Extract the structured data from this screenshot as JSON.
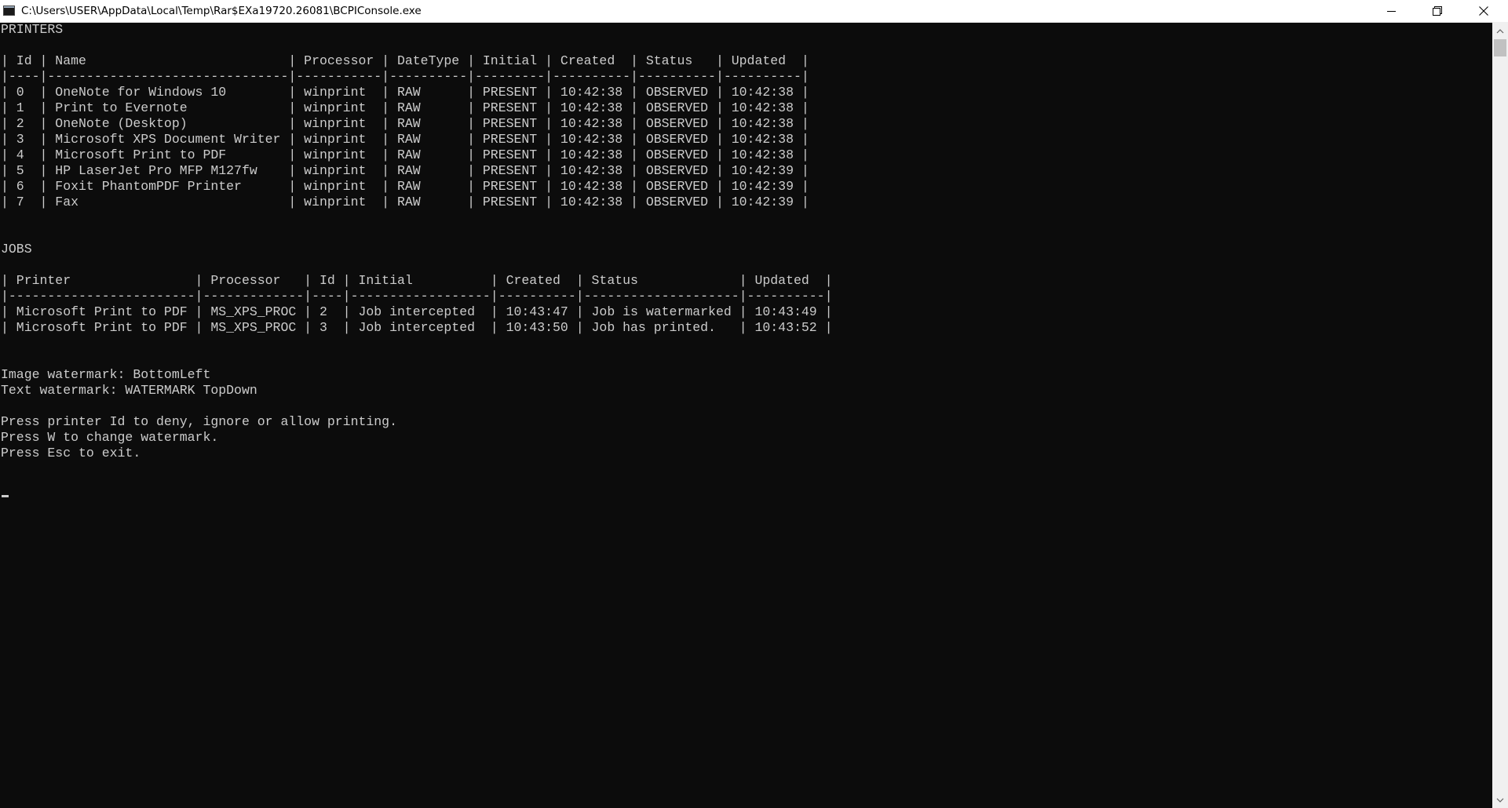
{
  "window": {
    "title": "C:\\Users\\USER\\AppData\\Local\\Temp\\Rar$EXa19720.26081\\BCPIConsole.exe",
    "buttons": [
      "minimize-icon",
      "restore-icon",
      "close-icon"
    ]
  },
  "console": {
    "printers_heading": "PRINTERS",
    "printers_table": {
      "header": "| Id | Name                          | Processor | DateType | Initial | Created  | Status   | Updated  |",
      "separator": "|----|-------------------------------|-----------|----------|---------|----------|----------|----------|",
      "rows": [
        "| 0  | OneNote for Windows 10        | winprint  | RAW      | PRESENT | 10:42:38 | OBSERVED | 10:42:38 |",
        "| 1  | Print to Evernote             | winprint  | RAW      | PRESENT | 10:42:38 | OBSERVED | 10:42:38 |",
        "| 2  | OneNote (Desktop)             | winprint  | RAW      | PRESENT | 10:42:38 | OBSERVED | 10:42:38 |",
        "| 3  | Microsoft XPS Document Writer | winprint  | RAW      | PRESENT | 10:42:38 | OBSERVED | 10:42:38 |",
        "| 4  | Microsoft Print to PDF        | winprint  | RAW      | PRESENT | 10:42:38 | OBSERVED | 10:42:38 |",
        "| 5  | HP LaserJet Pro MFP M127fw    | winprint  | RAW      | PRESENT | 10:42:38 | OBSERVED | 10:42:39 |",
        "| 6  | Foxit PhantomPDF Printer      | winprint  | RAW      | PRESENT | 10:42:38 | OBSERVED | 10:42:39 |",
        "| 7  | Fax                           | winprint  | RAW      | PRESENT | 10:42:38 | OBSERVED | 10:42:39 |"
      ]
    },
    "jobs_heading": "JOBS",
    "jobs_table": {
      "header": "| Printer                | Processor   | Id | Initial          | Created  | Status             | Updated  |",
      "separator": "|------------------------|-------------|----|------------------|----------|--------------------|----------|",
      "rows": [
        "| Microsoft Print to PDF | MS_XPS_PROC | 2  | Job intercepted  | 10:43:47 | Job is watermarked | 10:43:49 |",
        "| Microsoft Print to PDF | MS_XPS_PROC | 3  | Job intercepted  | 10:43:50 | Job has printed.   | 10:43:52 |"
      ]
    },
    "image_watermark": "Image watermark: BottomLeft",
    "text_watermark": "Text watermark: WATERMARK TopDown",
    "instructions": [
      "Press printer Id to deny, ignore or allow printing.",
      "Press W to change watermark.",
      "Press Esc to exit."
    ]
  },
  "colors": {
    "console_bg": "#0c0c0c",
    "console_text": "#cccccc",
    "titlebar_bg": "#ffffff"
  }
}
